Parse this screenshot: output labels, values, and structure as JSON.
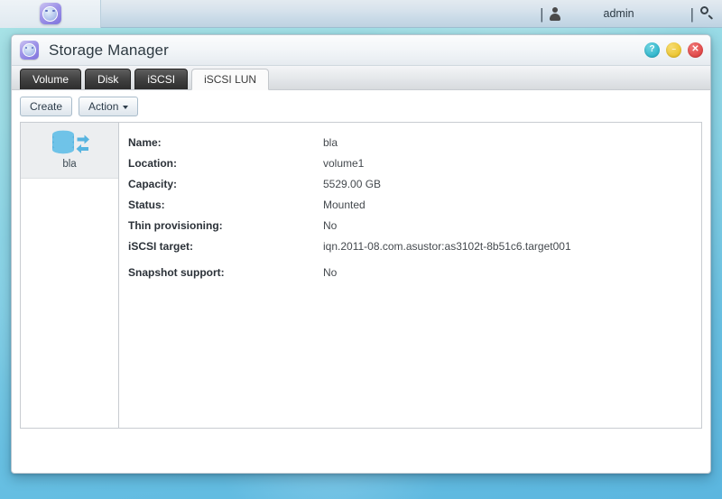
{
  "topbar": {
    "app_icon": "asustor-logo-icon",
    "separator": "|",
    "user_icon": "user-icon",
    "username": "admin",
    "search_icon": "search-icon"
  },
  "window": {
    "title": "Storage Manager",
    "icon": "asustor-logo-icon",
    "buttons": {
      "help": "?",
      "minimize": "–",
      "close": "✕"
    }
  },
  "tabs": [
    {
      "label": "Volume",
      "active": false
    },
    {
      "label": "Disk",
      "active": false
    },
    {
      "label": "iSCSI",
      "active": false
    },
    {
      "label": "iSCSI LUN",
      "active": true
    }
  ],
  "toolbar": {
    "create_label": "Create",
    "action_label": "Action"
  },
  "lun_list": [
    {
      "label": "bla",
      "icon": "iscsi-lun-icon",
      "selected": true
    }
  ],
  "details": [
    {
      "label": "Name:",
      "value": "bla"
    },
    {
      "label": "Location:",
      "value": "volume1"
    },
    {
      "label": "Capacity:",
      "value": "5529.00 GB"
    },
    {
      "label": "Status:",
      "value": "Mounted"
    },
    {
      "label": "Thin provisioning:",
      "value": "No"
    },
    {
      "label": "iSCSI target:",
      "value": "iqn.2011-08.com.asustor:as3102t-8b51c6.target001"
    },
    {
      "label": "Snapshot support:",
      "value": "No"
    }
  ],
  "colors": {
    "desktop_top": "#a9e3e6",
    "desktop_bottom": "#5bb6df",
    "tab_active_bg": "#fbfbfb",
    "tab_inactive_bg": "#3a3a3a",
    "accent_blue": "#4aa8d8",
    "help_button": "#31b6cd",
    "minimize_button": "#ecc52f",
    "close_button": "#e04747"
  }
}
